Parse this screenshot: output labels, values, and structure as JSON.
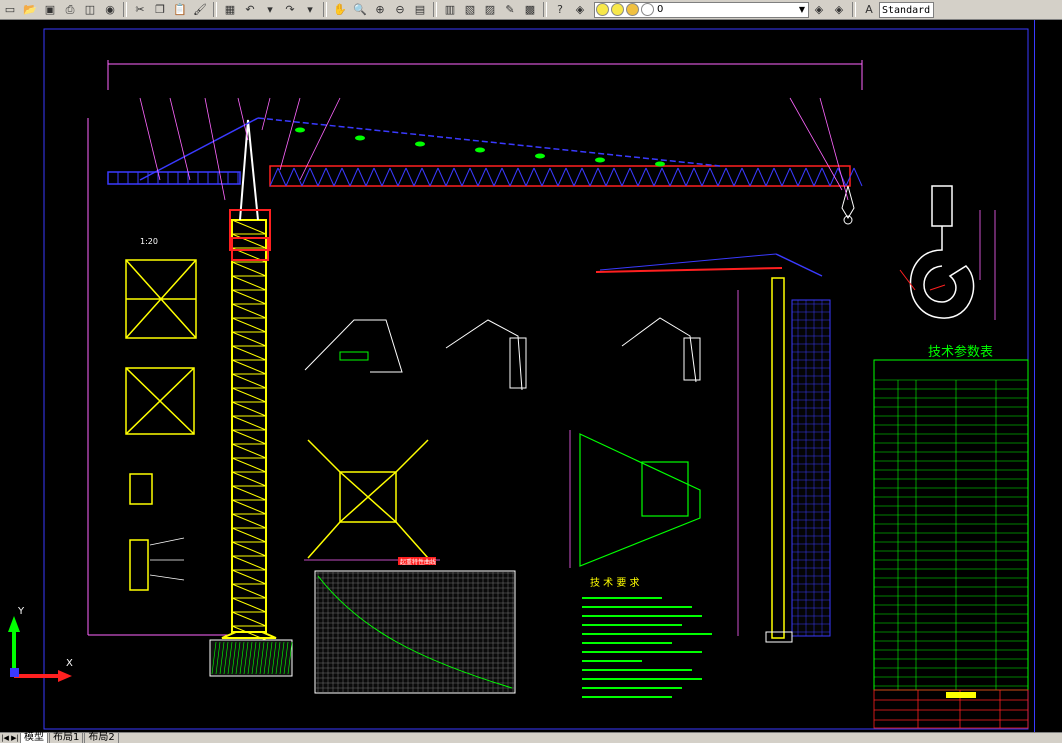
{
  "toolbar": {
    "icons": [
      "new-icon",
      "open-icon",
      "save-icon",
      "print-icon",
      "preview-icon",
      "publish-icon",
      "cut-icon",
      "copy-icon",
      "paste-icon",
      "match-properties-icon",
      "block-editor-icon",
      "undo-icon",
      "undo-dropdown-icon",
      "redo-icon",
      "redo-dropdown-icon",
      "pan-icon",
      "zoom-realtime-icon",
      "zoom-window-icon",
      "zoom-previous-icon",
      "properties-icon",
      "design-center-icon",
      "tool-palettes-icon",
      "sheet-set-icon",
      "markup-icon",
      "calculator-icon",
      "help-icon",
      "layer-manager-icon"
    ],
    "layer_combo": {
      "value": "0",
      "lightbulb": "#f7e84a",
      "sun": "#f7e84a",
      "lock": "#f0c040",
      "color": "#ffffff"
    },
    "text_style": "Standard"
  },
  "drawing": {
    "colors": {
      "frame": "#3a3aff",
      "crane": "#ffff00",
      "jib": "#ff2020",
      "hook": "#ffffff",
      "table": "#00ff00",
      "dim": "#ff66ff",
      "cyan": "#00ffff"
    },
    "tech_table_title": "技术参数表",
    "tech_requirements_title": "技 术 要 求",
    "chart_title": "起重特性曲线",
    "scale_label": "1:20",
    "ucs": {
      "x_label": "X",
      "y_label": "Y"
    }
  },
  "tabs": {
    "model": "模型",
    "layout1": "布局1",
    "layout2": "布局2"
  }
}
